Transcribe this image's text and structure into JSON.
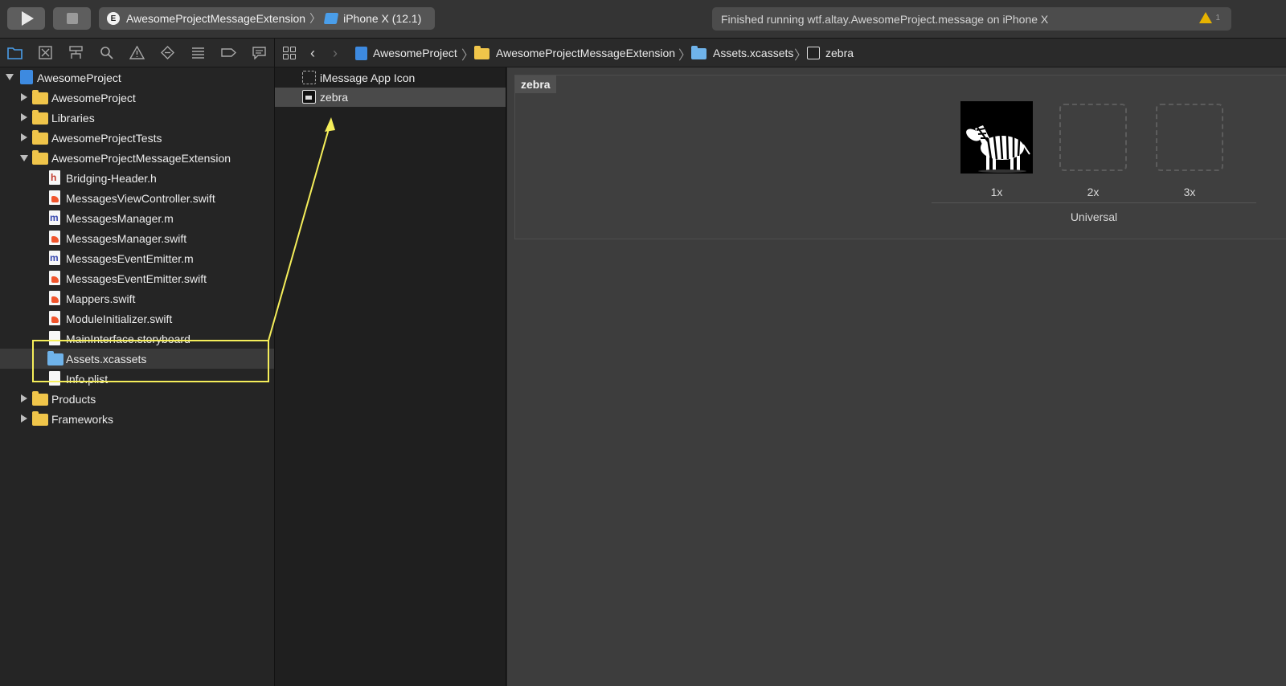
{
  "toolbar": {
    "scheme": {
      "badge": "E",
      "target": "AwesomeProjectMessageExtension",
      "device": "iPhone X (12.1)"
    },
    "status_text": "Finished running wtf.altay.AwesomeProject.message on iPhone X",
    "warning_count": "1"
  },
  "navigator_tabs": [
    "folder-icon",
    "source-control-icon",
    "hierarchy-icon",
    "search-icon",
    "warning-icon",
    "test-icon",
    "debug-icon",
    "breakpoint-icon",
    "report-icon"
  ],
  "tree": {
    "root": "AwesomeProject",
    "items": [
      {
        "label": "AwesomeProject",
        "kind": "folder"
      },
      {
        "label": "Libraries",
        "kind": "folder"
      },
      {
        "label": "AwesomeProjectTests",
        "kind": "folder"
      },
      {
        "label": "AwesomeProjectMessageExtension",
        "kind": "folder"
      },
      {
        "label": "Bridging-Header.h",
        "kind": "h"
      },
      {
        "label": "MessagesViewController.swift",
        "kind": "swift"
      },
      {
        "label": "MessagesManager.m",
        "kind": "m"
      },
      {
        "label": "MessagesManager.swift",
        "kind": "swift"
      },
      {
        "label": "MessagesEventEmitter.m",
        "kind": "m"
      },
      {
        "label": "MessagesEventEmitter.swift",
        "kind": "swift"
      },
      {
        "label": "Mappers.swift",
        "kind": "swift"
      },
      {
        "label": "ModuleInitializer.swift",
        "kind": "swift"
      },
      {
        "label": "MainInterface.storyboard",
        "kind": "storyboard"
      },
      {
        "label": "Assets.xcassets",
        "kind": "xcassets"
      },
      {
        "label": "Info.plist",
        "kind": "plist"
      },
      {
        "label": "Products",
        "kind": "folder"
      },
      {
        "label": "Frameworks",
        "kind": "folder"
      }
    ]
  },
  "jumpbar": {
    "crumbs": [
      "AwesomeProject",
      "AwesomeProjectMessageExtension",
      "Assets.xcassets",
      "zebra"
    ]
  },
  "assets": {
    "items": [
      "iMessage App Icon",
      "zebra"
    ],
    "selected": "zebra"
  },
  "detail": {
    "name": "zebra",
    "slots": [
      "1x",
      "2x",
      "3x"
    ],
    "idiom": "Universal"
  },
  "colors": {
    "annotation": "#f5ee5a",
    "folder": "#f0c54a",
    "accent": "#3d8ae0"
  }
}
